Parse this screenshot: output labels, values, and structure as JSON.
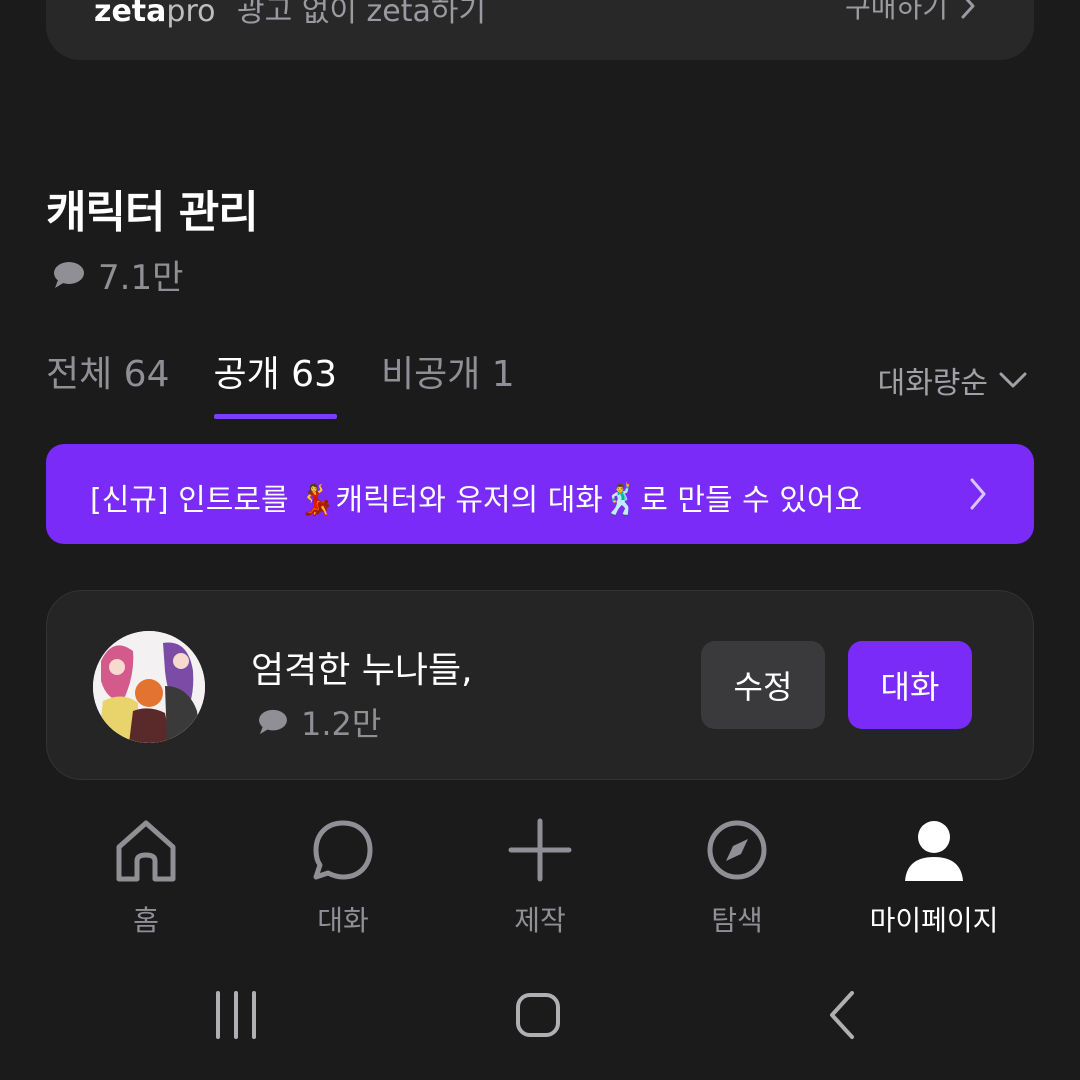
{
  "promo": {
    "brand": "zeta",
    "pro": "pro",
    "text": "광고 없이 zeta하기",
    "link": "구매하기"
  },
  "section": {
    "title": "캐릭터 관리",
    "total_chats": "7.1만"
  },
  "tabs": [
    {
      "label": "전체 64",
      "active": false
    },
    {
      "label": "공개 63",
      "active": true
    },
    {
      "label": "비공개 1",
      "active": false
    }
  ],
  "sort": {
    "label": "대화량순"
  },
  "banner": {
    "text": "[신규] 인트로를 💃캐릭터와 유저의 대화🕺로 만들 수 있어요"
  },
  "characters": [
    {
      "name": "엄격한 누나들,",
      "chats": "1.2만",
      "edit_label": "수정",
      "chat_label": "대화"
    }
  ],
  "bottom_nav": [
    {
      "label": "홈",
      "icon": "home-icon"
    },
    {
      "label": "대화",
      "icon": "chat-bubble-icon"
    },
    {
      "label": "제작",
      "icon": "plus-icon"
    },
    {
      "label": "탐색",
      "icon": "compass-icon"
    },
    {
      "label": "마이페이지",
      "icon": "user-icon"
    }
  ],
  "colors": {
    "accent": "#7a2bf8",
    "background": "#1b1b1b",
    "card": "#252525"
  }
}
